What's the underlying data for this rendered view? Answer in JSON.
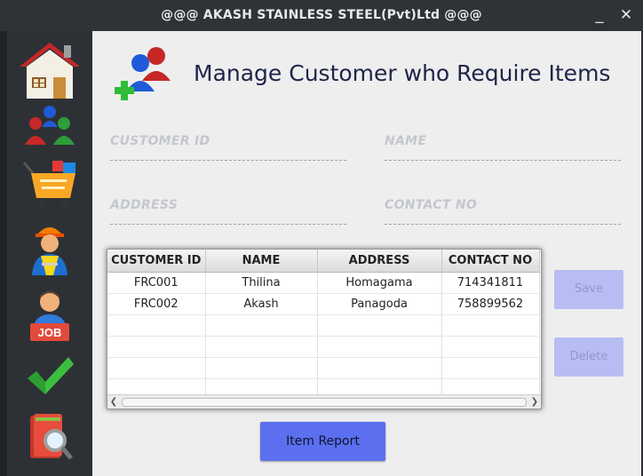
{
  "window": {
    "title": "@@@ AKASH STAINLESS STEEL(Pvt)Ltd @@@",
    "minimize_glyph": "_",
    "close_glyph": "✕"
  },
  "sidebar": {
    "items": [
      {
        "name": "home",
        "icon": "home-icon"
      },
      {
        "name": "customers",
        "icon": "customers-icon"
      },
      {
        "name": "items",
        "icon": "shopping-cart-icon"
      },
      {
        "name": "workers",
        "icon": "worker-icon"
      },
      {
        "name": "jobs",
        "icon": "job-icon",
        "badge": "JOB"
      },
      {
        "name": "complete",
        "icon": "checkmark-icon"
      },
      {
        "name": "search-report",
        "icon": "search-report-icon"
      }
    ]
  },
  "main": {
    "heading": "Manage Customer who Require Items",
    "fields": {
      "customer_id": {
        "label": "CUSTOMER ID",
        "value": ""
      },
      "name": {
        "label": "NAME",
        "value": ""
      },
      "address": {
        "label": "ADDRESS",
        "value": ""
      },
      "contact_no": {
        "label": "CONTACT NO",
        "value": ""
      }
    },
    "table": {
      "columns": [
        "CUSTOMER ID",
        "NAME",
        "ADDRESS",
        "CONTACT NO"
      ],
      "rows": [
        [
          "FRC001",
          "Thilina",
          "Homagama",
          "714341811"
        ],
        [
          "FRC002",
          "Akash",
          "Panagoda",
          "758899562"
        ]
      ]
    },
    "buttons": {
      "save": "Save",
      "delete": "Delete",
      "item_report": "Item Report"
    }
  },
  "colors": {
    "accent": "#5b6fef",
    "disabled_button": "#b7bdf2",
    "heading": "#20254a"
  }
}
